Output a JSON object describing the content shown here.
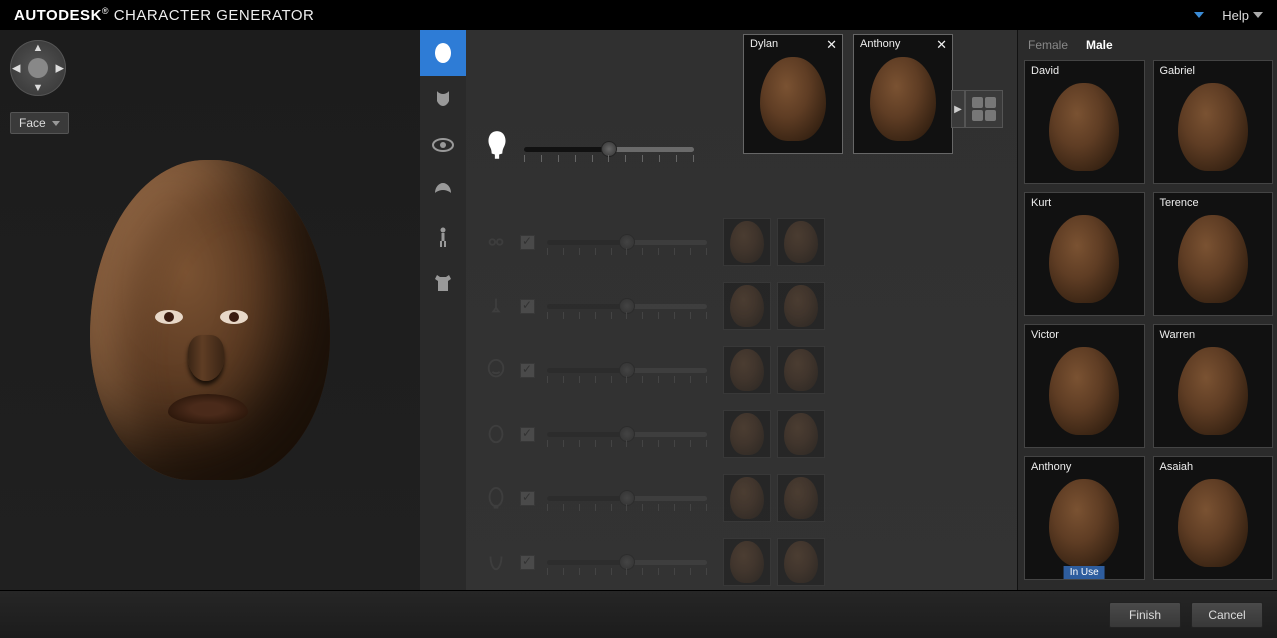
{
  "header": {
    "brand_a": "AUTODESK",
    "brand_b": "CHARACTER GENERATOR",
    "help": "Help"
  },
  "viewport": {
    "view_mode": "Face"
  },
  "categories": [
    {
      "name": "face",
      "active": true
    },
    {
      "name": "skin",
      "active": false
    },
    {
      "name": "eyes",
      "active": false
    },
    {
      "name": "hair",
      "active": false
    },
    {
      "name": "body",
      "active": false
    },
    {
      "name": "clothing",
      "active": false
    }
  ],
  "sources": [
    {
      "name": "Dylan"
    },
    {
      "name": "Anthony"
    }
  ],
  "master_slider": {
    "value": 0.5
  },
  "features": [
    {
      "name": "eyes-region",
      "checked": true,
      "value": 0.5
    },
    {
      "name": "nose-region",
      "checked": true,
      "value": 0.5
    },
    {
      "name": "mouth-region",
      "checked": true,
      "value": 0.5
    },
    {
      "name": "ears-region",
      "checked": true,
      "value": 0.5
    },
    {
      "name": "head-shape-region",
      "checked": true,
      "value": 0.5
    },
    {
      "name": "chin-region",
      "checked": true,
      "value": 0.5
    }
  ],
  "library": {
    "tab_female": "Female",
    "tab_male": "Male",
    "active_tab": "Male",
    "items": [
      {
        "name": "David"
      },
      {
        "name": "Gabriel"
      },
      {
        "name": "Kurt"
      },
      {
        "name": "Terence"
      },
      {
        "name": "Victor"
      },
      {
        "name": "Warren"
      },
      {
        "name": "Anthony",
        "in_use": true,
        "in_use_label": "In Use"
      },
      {
        "name": "Asaiah"
      }
    ]
  },
  "footer": {
    "finish": "Finish",
    "cancel": "Cancel"
  }
}
